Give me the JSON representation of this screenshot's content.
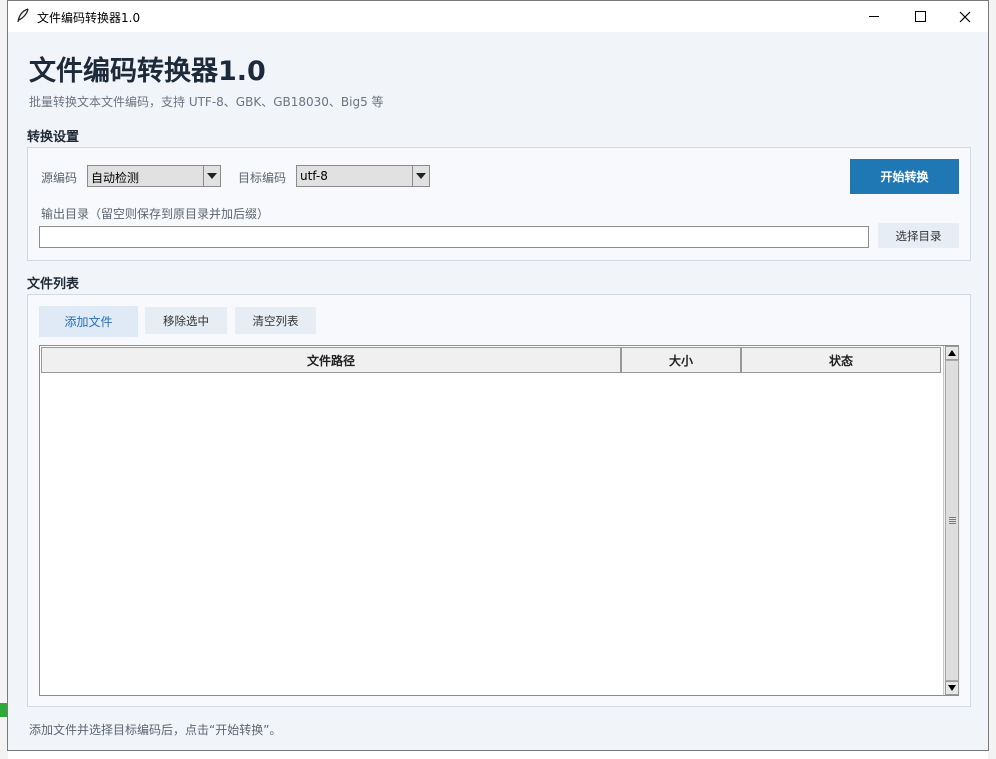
{
  "window": {
    "title": "文件编码转换器1.0"
  },
  "header": {
    "title": "文件编码转换器1.0",
    "subtitle": "批量转换文本文件编码，支持 UTF-8、GBK、GB18030、Big5 等"
  },
  "settings": {
    "section_title": "转换设置",
    "source_label": "源编码",
    "source_value": "自动检测",
    "target_label": "目标编码",
    "target_value": "utf-8",
    "start_button": "开始转换",
    "output_label": "输出目录（留空则保存到原目录并加后缀）",
    "output_value": "",
    "browse_button": "选择目录"
  },
  "files": {
    "section_title": "文件列表",
    "add_button": "添加文件",
    "remove_button": "移除选中",
    "clear_button": "清空列表",
    "columns": [
      "文件路径",
      "大小",
      "状态"
    ],
    "rows": []
  },
  "status": {
    "text": "添加文件并选择目标编码后，点击“开始转换”。"
  },
  "colors": {
    "primary": "#1f78b4",
    "window_bg": "#f1f5fa",
    "heading": "#1c2a3a"
  },
  "icons": [
    "feather-icon",
    "minimize-icon",
    "maximize-icon",
    "close-icon",
    "dropdown-arrow-icon",
    "scroll-up-icon",
    "scroll-down-icon"
  ]
}
